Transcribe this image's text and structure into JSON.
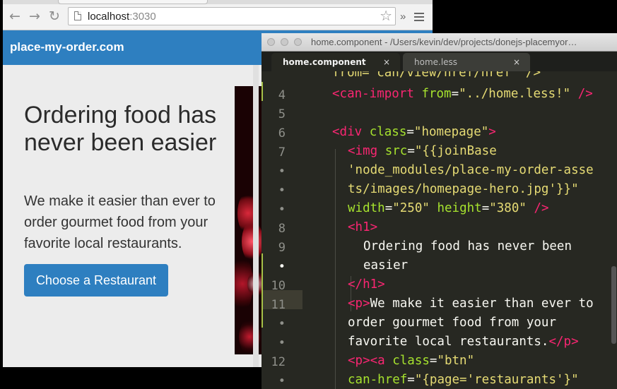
{
  "browser": {
    "url_host": "localhost",
    "url_port": ":3030",
    "nav": {
      "back": "←",
      "forward": "→",
      "reload": "↻"
    },
    "star": "☆",
    "extensions": "»"
  },
  "site": {
    "brand": "place-my-order.com",
    "hero_title": "Ordering food has never been easier",
    "hero_lead": "We make it easier than ever to order gourmet food from your favorite local restaurants.",
    "cta_label": "Choose a Restaurant"
  },
  "editor": {
    "window_title": "home.component - /Users/kevin/dev/projects/donejs-placemyor…",
    "tabs": [
      {
        "label": "home.component",
        "close": "×",
        "active": true
      },
      {
        "label": "home.less",
        "close": "×",
        "active": false
      }
    ],
    "gutter": [
      "4",
      "5",
      "6",
      "7",
      "•",
      "•",
      "•",
      "8",
      "9",
      "•",
      "10",
      "11",
      "•",
      "•",
      "12",
      "•"
    ],
    "partial_top_line": "from=\"can/view/href/href\" />",
    "lines": {
      "l4_a": "<can-import",
      "l4_b": " from",
      "l4_c": "=",
      "l4_d": "\"../home.less!\"",
      "l4_e": " />",
      "l6_a": "<div",
      "l6_b": " class",
      "l6_c": "=",
      "l6_d": "\"homepage\"",
      "l6_e": ">",
      "l7_a": "<img",
      "l7_b": " src",
      "l7_c": "=",
      "l7_d": "\"{{joinBase",
      "l7w1": "'node_modules/place-my-order-asse",
      "l7w2": "ts/images/homepage-hero.jpg'}}\"",
      "l7w3_a": "width",
      "l7w3_b": "=",
      "l7w3_c": "\"250\"",
      "l7w3_d": " height",
      "l7w3_e": "=",
      "l7w3_f": "\"380\"",
      "l7w3_g": " />",
      "l8": "<h1>",
      "l9": "Ordering food has never been",
      "l9w": "easier",
      "l10": "</h1>",
      "l11_a": "<p>",
      "l11_b": "We make it easier than ever to",
      "l11w1": "order gourmet food from your",
      "l11w2_a": "favorite local restaurants.",
      "l11w2_b": "</p>",
      "l12_a": "<p><a",
      "l12_b": " class",
      "l12_c": "=",
      "l12_d": "\"btn\"",
      "l12w_a": "can-href",
      "l12w_b": "=",
      "l12w_c": "\"{page='restaurants'}\""
    }
  },
  "colors": {
    "brand_blue": "#2e7fc0",
    "editor_bg": "#272822",
    "tag": "#f92672",
    "attr": "#a6e22e",
    "string": "#e6db74"
  }
}
